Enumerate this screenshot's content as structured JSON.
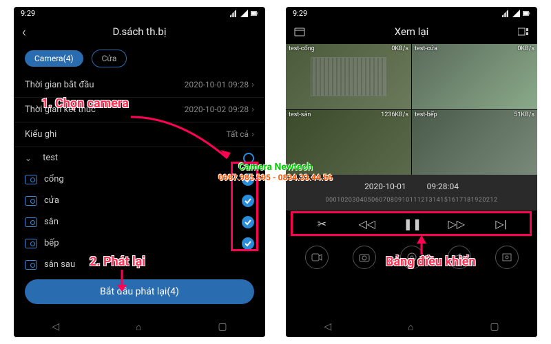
{
  "status": {
    "time": "9:29"
  },
  "left": {
    "title": "D.sách th.bị",
    "tab_camera": "Camera(4)",
    "tab_door": "Cửa",
    "start_label": "Thời gian bắt đầu",
    "start_value": "2020-10-01 09:28",
    "end_label": "Thời gian kết thúc",
    "end_value": "2020-10-02 09:28",
    "record_type_label": "Kiểu ghi",
    "record_type_value": "Tất cả",
    "group": "test",
    "cameras": [
      "cổng",
      "cửa",
      "sân",
      "bếp",
      "sân sau"
    ],
    "start_btn": "Bắt đầu phát lại(4)"
  },
  "right": {
    "title": "Xem lại",
    "cams": [
      {
        "label": "test-cổng",
        "rate": "0KB/s"
      },
      {
        "label": "test-cửa",
        "rate": "0KB/s"
      },
      {
        "label": "test-sân",
        "rate": "1236KB/s"
      },
      {
        "label": "test-bếp",
        "rate": "51KB/s"
      }
    ],
    "date": "2020-10-01",
    "time": "09:28:04",
    "ruler": "000102030405060708091011121314151617181920212"
  },
  "annotations": {
    "step1": "1. Chọn camera",
    "step2": "2. Phát lại",
    "panel": "Bảng điều khiển"
  },
  "watermark": {
    "line1": "Camera Newtech",
    "line2": "0987.985.595 - 0834.33.44.56"
  }
}
